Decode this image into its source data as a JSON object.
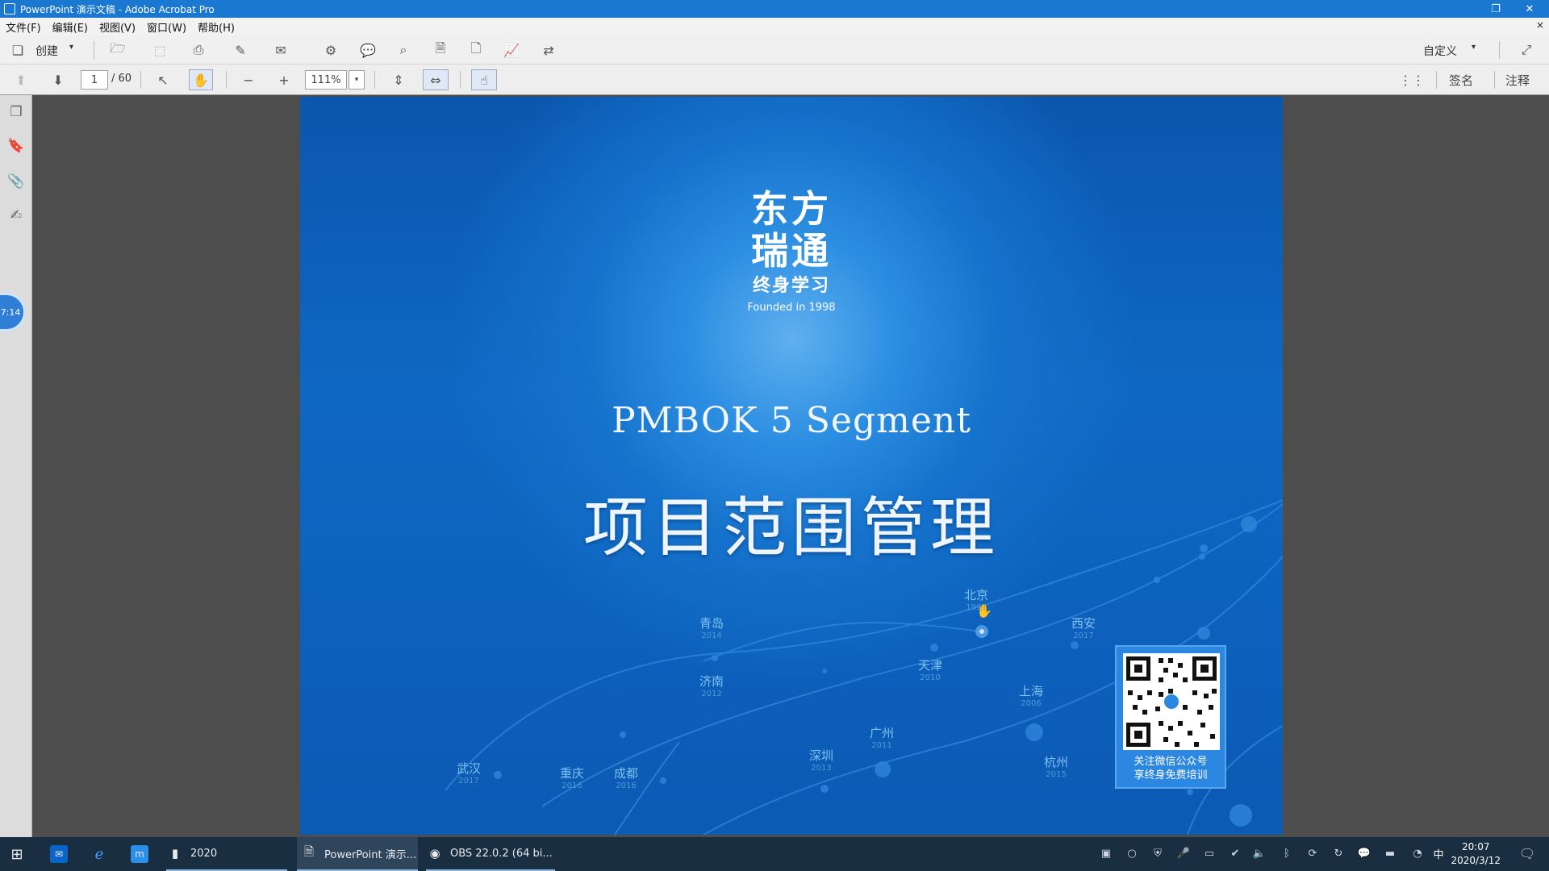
{
  "window": {
    "title": "PowerPoint 演示文稿 - Adobe Acrobat Pro",
    "restore_symbol": "❐",
    "close_symbol": "✕"
  },
  "menu": {
    "items": [
      "文件(F)",
      "编辑(E)",
      "视图(V)",
      "窗口(W)",
      "帮助(H)"
    ],
    "close_doc": "×"
  },
  "toolbar": {
    "create_label": "创建",
    "customize_label": "自定义"
  },
  "nav": {
    "page_current": "1",
    "page_total": "/ 60",
    "zoom": "111%",
    "sign_label": "签名",
    "comment_label": "注释"
  },
  "side_badge": "7:14",
  "slide": {
    "logo_line1": "东方",
    "logo_line2": "瑞通",
    "logo_line3": "终身学习",
    "logo_founded": "Founded in 1998",
    "subtitle": "PMBOK 5 Segment",
    "title": "项目范围管理",
    "cities": [
      {
        "name": "北京",
        "year": "1998"
      },
      {
        "name": "青岛",
        "year": "2014"
      },
      {
        "name": "西安",
        "year": "2017"
      },
      {
        "name": "济南",
        "year": "2012"
      },
      {
        "name": "天津",
        "year": "2010"
      },
      {
        "name": "上海",
        "year": "2006"
      },
      {
        "name": "广州",
        "year": "2011"
      },
      {
        "name": "深圳",
        "year": "2013"
      },
      {
        "name": "杭州",
        "year": "2015"
      },
      {
        "name": "武汉",
        "year": "2017"
      },
      {
        "name": "重庆",
        "year": "2016"
      },
      {
        "name": "成都",
        "year": "2016"
      }
    ],
    "qr_caption_line1": "关注微信公众号",
    "qr_caption_line2": "享终身免费培训"
  },
  "taskbar": {
    "items": [
      {
        "label": "2020"
      },
      {
        "label": "PowerPoint 演示..."
      },
      {
        "label": "OBS 22.0.2 (64 bi..."
      }
    ],
    "ime": "中",
    "time": "20:07",
    "date": "2020/3/12"
  }
}
